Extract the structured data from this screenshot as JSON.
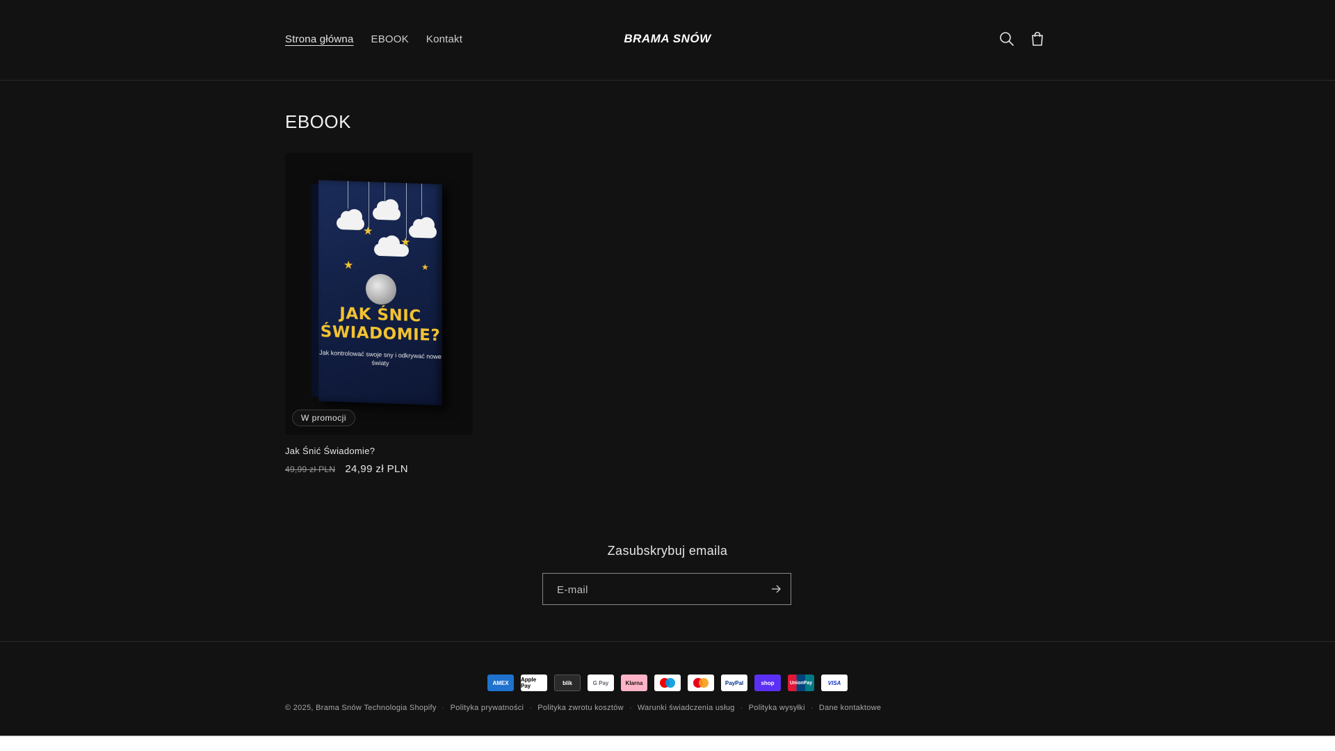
{
  "header": {
    "nav": [
      "Strona główna",
      "EBOOK",
      "Kontakt"
    ],
    "logo": "BRAMA SNÓW",
    "search_icon": "search-icon",
    "cart_icon": "cart-icon"
  },
  "main": {
    "title": "EBOOK",
    "product": {
      "cover_title": "JAK ŚNIC ŚWIADOMIE?",
      "cover_subtitle": "Jak kontrolować swoje sny i odkrywać nowe światy",
      "badge": "W promocji",
      "name": "Jak Śnić Świadomie?",
      "old_price": "49,99 zł PLN",
      "new_price": "24,99 zł PLN"
    }
  },
  "newsletter": {
    "title": "Zasubskrybuj emaila",
    "placeholder": "E-mail",
    "submit_icon": "arrow-right-icon"
  },
  "footer": {
    "payments": [
      "AMEX",
      "Apple Pay",
      "blik",
      "G Pay",
      "Klarna",
      "Maestro",
      "Mastercard",
      "PayPal",
      "shop",
      "UnionPay",
      "VISA"
    ],
    "copyright": "© 2025,",
    "store_name": "Brama Snów",
    "powered": "Technologia Shopify",
    "links": [
      "Polityka prywatności",
      "Polityka zwrotu kosztów",
      "Warunki świadczenia usług",
      "Polityka wysyłki",
      "Dane kontaktowe"
    ]
  },
  "colors": {
    "background": "#121212",
    "text": "#e6e6e6",
    "accent_yellow": "#f2c230"
  }
}
